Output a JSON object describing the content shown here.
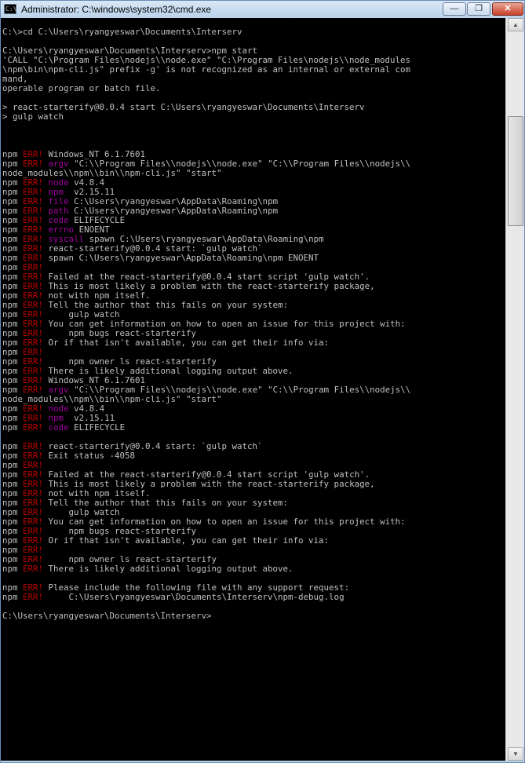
{
  "window": {
    "title": "Administrator: C:\\windows\\system32\\cmd.exe",
    "app_icon_text": "C:\\",
    "controls": {
      "minimize": "—",
      "maximize": "❐",
      "close": "✕"
    }
  },
  "scrollbar": {
    "up": "▲",
    "down": "▼",
    "position_fraction": 0.14
  },
  "console": {
    "lines": [
      {
        "t": ""
      },
      {
        "t": "C:\\>cd C:\\Users\\ryangyeswar\\Documents\\Interserv"
      },
      {
        "t": ""
      },
      {
        "t": "C:\\Users\\ryangyeswar\\Documents\\Interserv>npm start"
      },
      {
        "t": "'CALL \"C:\\Program Files\\nodejs\\\\node.exe\" \"C:\\Program Files\\nodejs\\\\node_modules"
      },
      {
        "t": "\\npm\\bin\\npm-cli.js\" prefix -g' is not recognized as an internal or external com"
      },
      {
        "t": "mand,"
      },
      {
        "t": "operable program or batch file."
      },
      {
        "t": ""
      },
      {
        "t": "> react-starterify@0.0.4 start C:\\Users\\ryangyeswar\\Documents\\Interserv"
      },
      {
        "t": "> gulp watch"
      },
      {
        "t": ""
      },
      {
        "t": ""
      },
      {
        "t": ""
      },
      {
        "t": "Windows_NT 6.1.7601",
        "e": true
      },
      {
        "t": "\"C:\\\\Program Files\\\\nodejs\\\\node.exe\" \"C:\\\\Program Files\\\\nodejs\\\\",
        "e": true,
        "k": "argv"
      },
      {
        "t": "node_modules\\\\npm\\\\bin\\\\npm-cli.js\" \"start\""
      },
      {
        "t": "v4.8.4",
        "e": true,
        "k": "node"
      },
      {
        "t": " v2.15.11",
        "e": true,
        "k": "npm"
      },
      {
        "t": "C:\\Users\\ryangyeswar\\AppData\\Roaming\\npm",
        "e": true,
        "k": "file"
      },
      {
        "t": "C:\\Users\\ryangyeswar\\AppData\\Roaming\\npm",
        "e": true,
        "k": "path"
      },
      {
        "t": "ELIFECYCLE",
        "e": true,
        "k": "code"
      },
      {
        "t": "ENOENT",
        "e": true,
        "k": "errno"
      },
      {
        "t": "spawn C:\\Users\\ryangyeswar\\AppData\\Roaming\\npm",
        "e": true,
        "k": "syscall"
      },
      {
        "t": "react-starterify@0.0.4 start: `gulp watch`",
        "e": true
      },
      {
        "t": "spawn C:\\Users\\ryangyeswar\\AppData\\Roaming\\npm ENOENT",
        "e": true
      },
      {
        "t": "",
        "e": true
      },
      {
        "t": "Failed at the react-starterify@0.0.4 start script 'gulp watch'.",
        "e": true
      },
      {
        "t": "This is most likely a problem with the react-starterify package,",
        "e": true
      },
      {
        "t": "not with npm itself.",
        "e": true
      },
      {
        "t": "Tell the author that this fails on your system:",
        "e": true
      },
      {
        "t": "    gulp watch",
        "e": true
      },
      {
        "t": "You can get information on how to open an issue for this project with:",
        "e": true
      },
      {
        "t": "    npm bugs react-starterify",
        "e": true
      },
      {
        "t": "Or if that isn't available, you can get their info via:",
        "e": true
      },
      {
        "t": "",
        "e": true
      },
      {
        "t": "    npm owner ls react-starterify",
        "e": true
      },
      {
        "t": "There is likely additional logging output above.",
        "e": true
      },
      {
        "t": "Windows_NT 6.1.7601",
        "e": true
      },
      {
        "t": "\"C:\\\\Program Files\\\\nodejs\\\\node.exe\" \"C:\\\\Program Files\\\\nodejs\\\\",
        "e": true,
        "k": "argv"
      },
      {
        "t": "node_modules\\\\npm\\\\bin\\\\npm-cli.js\" \"start\""
      },
      {
        "t": "v4.8.4",
        "e": true,
        "k": "node"
      },
      {
        "t": " v2.15.11",
        "e": true,
        "k": "npm"
      },
      {
        "t": "ELIFECYCLE",
        "e": true,
        "k": "code"
      },
      {
        "t": ""
      },
      {
        "t": "react-starterify@0.0.4 start: `gulp watch`",
        "e": true
      },
      {
        "t": "Exit status -4058",
        "e": true
      },
      {
        "t": "",
        "e": true
      },
      {
        "t": "Failed at the react-starterify@0.0.4 start script 'gulp watch'.",
        "e": true
      },
      {
        "t": "This is most likely a problem with the react-starterify package,",
        "e": true
      },
      {
        "t": "not with npm itself.",
        "e": true
      },
      {
        "t": "Tell the author that this fails on your system:",
        "e": true
      },
      {
        "t": "    gulp watch",
        "e": true
      },
      {
        "t": "You can get information on how to open an issue for this project with:",
        "e": true
      },
      {
        "t": "    npm bugs react-starterify",
        "e": true
      },
      {
        "t": "Or if that isn't available, you can get their info via:",
        "e": true
      },
      {
        "t": "",
        "e": true
      },
      {
        "t": "    npm owner ls react-starterify",
        "e": true
      },
      {
        "t": "There is likely additional logging output above.",
        "e": true
      },
      {
        "t": ""
      },
      {
        "t": "Please include the following file with any support request:",
        "e": true
      },
      {
        "t": "    C:\\Users\\ryangyeswar\\Documents\\Interserv\\npm-debug.log",
        "e": true
      },
      {
        "t": ""
      },
      {
        "t": "C:\\Users\\ryangyeswar\\Documents\\Interserv>"
      }
    ]
  }
}
